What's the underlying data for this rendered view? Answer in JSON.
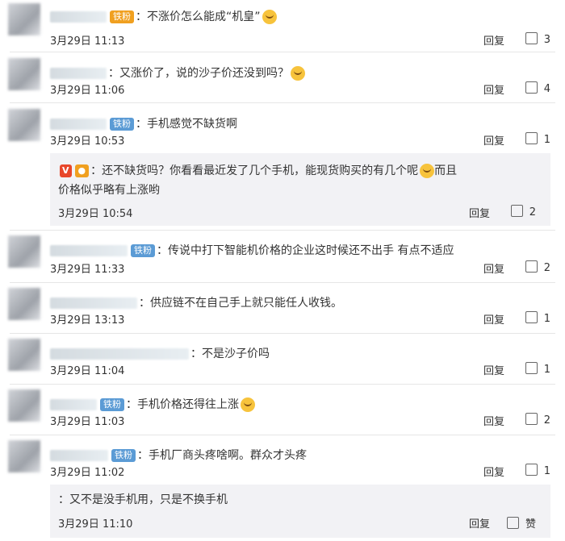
{
  "comments": [
    {
      "text": "：不涨价怎么能成“机皇”",
      "badge": "铁粉",
      "time": "3月29日 11:13",
      "reply": "回复",
      "likes": "3"
    },
    {
      "text": "：又涨价了，说的沙子价还没到吗？",
      "time": "3月29日 11:06",
      "reply": "回复",
      "likes": "4"
    },
    {
      "text": "：手机感觉不缺货啊",
      "badge": "铁粉",
      "time": "3月29日 10:53",
      "reply": "回复",
      "likes": "1"
    },
    {
      "text": "：传说中打下智能机价格的企业这时候还不出手  有点不适应",
      "badge": "铁粉",
      "time": "3月29日 11:33",
      "reply": "回复",
      "likes": "2"
    },
    {
      "text": "：供应链不在自己手上就只能任人收钱。",
      "time": "3月29日 13:13",
      "reply": "回复",
      "likes": "1"
    },
    {
      "text": "：不是沙子价吗",
      "time": "3月29日 11:04",
      "reply": "回复",
      "likes": "1"
    },
    {
      "text": "：手机价格还得往上涨",
      "badge": "铁粉",
      "time": "3月29日 11:03",
      "reply": "回复",
      "likes": "2"
    },
    {
      "text": "：手机厂商头疼啥啊。群众才头疼",
      "badge": "铁粉",
      "time": "3月29日 11:02",
      "reply": "回复",
      "likes": "1"
    }
  ],
  "replies": [
    {
      "line1": "：还不缺货吗？你看看最近发了几个手机，能现货购买的有几个呢",
      "line2": "而且",
      "line3": "价格似乎略有上涨哟",
      "time": "3月29日 10:54",
      "reply": "回复",
      "likes": "2"
    },
    {
      "text": "：又不是没手机用，只是不换手机",
      "time": "3月29日 11:10",
      "reply": "回复",
      "likes": "赞"
    }
  ],
  "colors": {
    "badge_blue": "#5b9bd5",
    "badge_gold": "#f0a020",
    "reply_bg": "#f2f2f5"
  }
}
